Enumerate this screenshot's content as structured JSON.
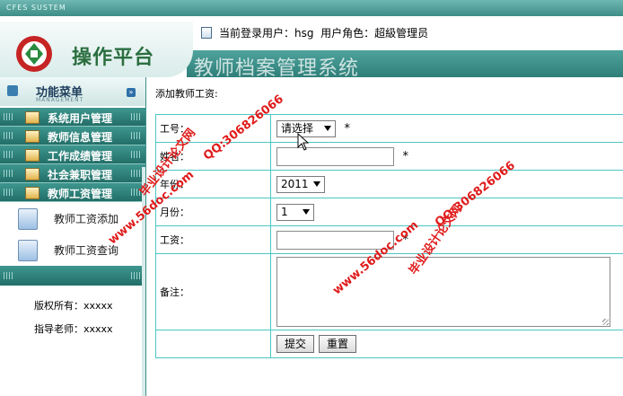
{
  "topbar": {
    "system_text": "CFES SUSTEM"
  },
  "header": {
    "platform_title": "操作平台",
    "current_user_label": "当前登录用户：",
    "current_user": "hsg",
    "role_label": "用户角色：",
    "role": "超級管理员",
    "system_title": "教师档案管理系统"
  },
  "sidebar": {
    "menu_title": "功能菜单",
    "menu_subtitle": "MANAGEMENT",
    "items": [
      {
        "label": "系统用户管理"
      },
      {
        "label": "教师信息管理"
      },
      {
        "label": "工作成绩管理"
      },
      {
        "label": "社会兼职管理"
      },
      {
        "label": "教师工资管理"
      }
    ],
    "sub_items": [
      {
        "label": "教师工资添加"
      },
      {
        "label": "教师工资查询"
      }
    ],
    "copyright": "版权所有：xxxxx",
    "advisor": "指导老师：xxxxx"
  },
  "main": {
    "heading": "添加教师工资:",
    "form": {
      "teacher_id_label": "工号：",
      "teacher_id_value": "请选择",
      "name_label": "姓名：",
      "name_value": "",
      "year_label": "年份：",
      "year_value": "2011",
      "month_label": "月份：",
      "month_value": "1",
      "salary_label": "工资：",
      "salary_value": "",
      "remark_label": "备注：",
      "remark_value": "",
      "required_mark": "*",
      "submit_label": "提交",
      "reset_label": "重置"
    }
  },
  "watermarks": {
    "site": "www.56doc.com",
    "qq": "QQ:306826066",
    "brand": "毕业设计论文网"
  },
  "colors": {
    "teal": "#2f7f79",
    "border": "#4cc5c5",
    "watermark": "#e01b1b"
  }
}
